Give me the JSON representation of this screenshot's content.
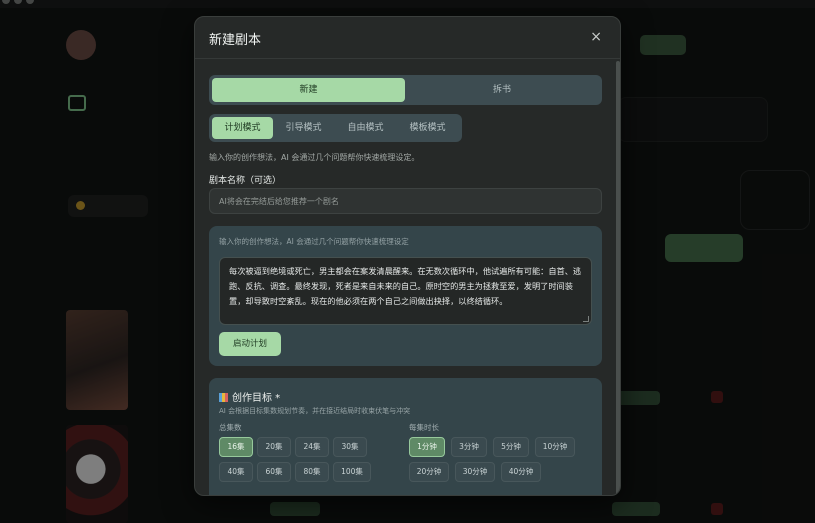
{
  "modal": {
    "title": "新建剧本",
    "close_icon": "×",
    "modes": [
      "新建",
      "拆书"
    ],
    "sub_tabs": [
      "计划模式",
      "引导模式",
      "自由模式",
      "模板模式"
    ],
    "hint": "输入你的创作想法，AI 会通过几个问题帮你快速梳理设定。",
    "name_label": "剧本名称（可选）",
    "name_placeholder": "AI将会在完结后给您推荐一个剧名",
    "plan": {
      "hint": "输入你的创作想法，AI 会通过几个问题帮你快速梳理设定",
      "text": "每次被逼到绝境或死亡，男主都会在案发清晨醒来。在无数次循环中，他试遍所有可能：自首、逃跑、反抗、调查。最终发现，死者是来自未来的自己。原时空的男主为拯救至爱，发明了时间装置，却导致时空紊乱。现在的他必须在两个自己之间做出抉择，以终结循环。",
      "start_label": "启动计划"
    },
    "goal": {
      "title": "创作目标 *",
      "subtitle": "AI 会根据目标集数规划节奏，并在接近结局时收束伏笔与冲突",
      "episodes_label": "总集数",
      "episodes": [
        "16集",
        "20集",
        "24集",
        "30集",
        "40集",
        "60集",
        "80集",
        "100集"
      ],
      "episodes_selected": "16集",
      "duration_label": "每集时长",
      "durations": [
        "1分钟",
        "3分钟",
        "5分钟",
        "10分钟",
        "20分钟",
        "30分钟",
        "40分钟"
      ],
      "duration_selected": "1分钟"
    }
  }
}
